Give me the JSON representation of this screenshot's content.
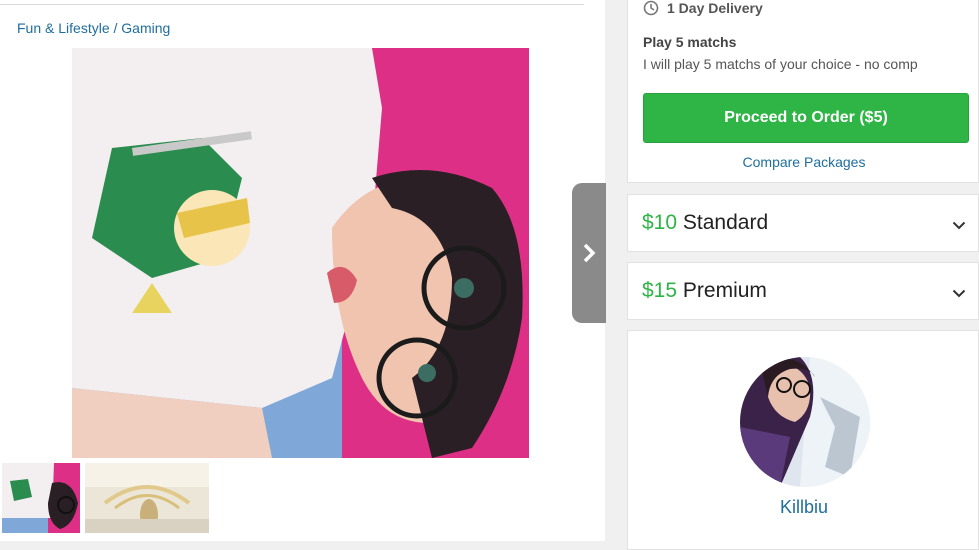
{
  "breadcrumb": {
    "category": "Fun & Lifestyle",
    "separator": " / ",
    "subcategory": "Gaming"
  },
  "gallery": {
    "main_image_icon": "selfie-photo",
    "thumbnails": [
      "thumbnail-selfie",
      "thumbnail-game-art"
    ],
    "next_icon": "chevron-right-icon"
  },
  "basic_package": {
    "delivery_icon": "clock-icon",
    "delivery": "1 Day Delivery",
    "title": "Play 5 matchs",
    "description": "I will play 5 matchs of your choice - no comp",
    "order_button": "Proceed to Order ($5)",
    "compare_link": "Compare Packages"
  },
  "packages": [
    {
      "price": "$10",
      "name": "Standard"
    },
    {
      "price": "$15",
      "name": "Premium"
    }
  ],
  "seller": {
    "name": "Killbiu"
  },
  "colors": {
    "accent_green": "#2fb446",
    "link_blue": "#1e6e9e"
  }
}
